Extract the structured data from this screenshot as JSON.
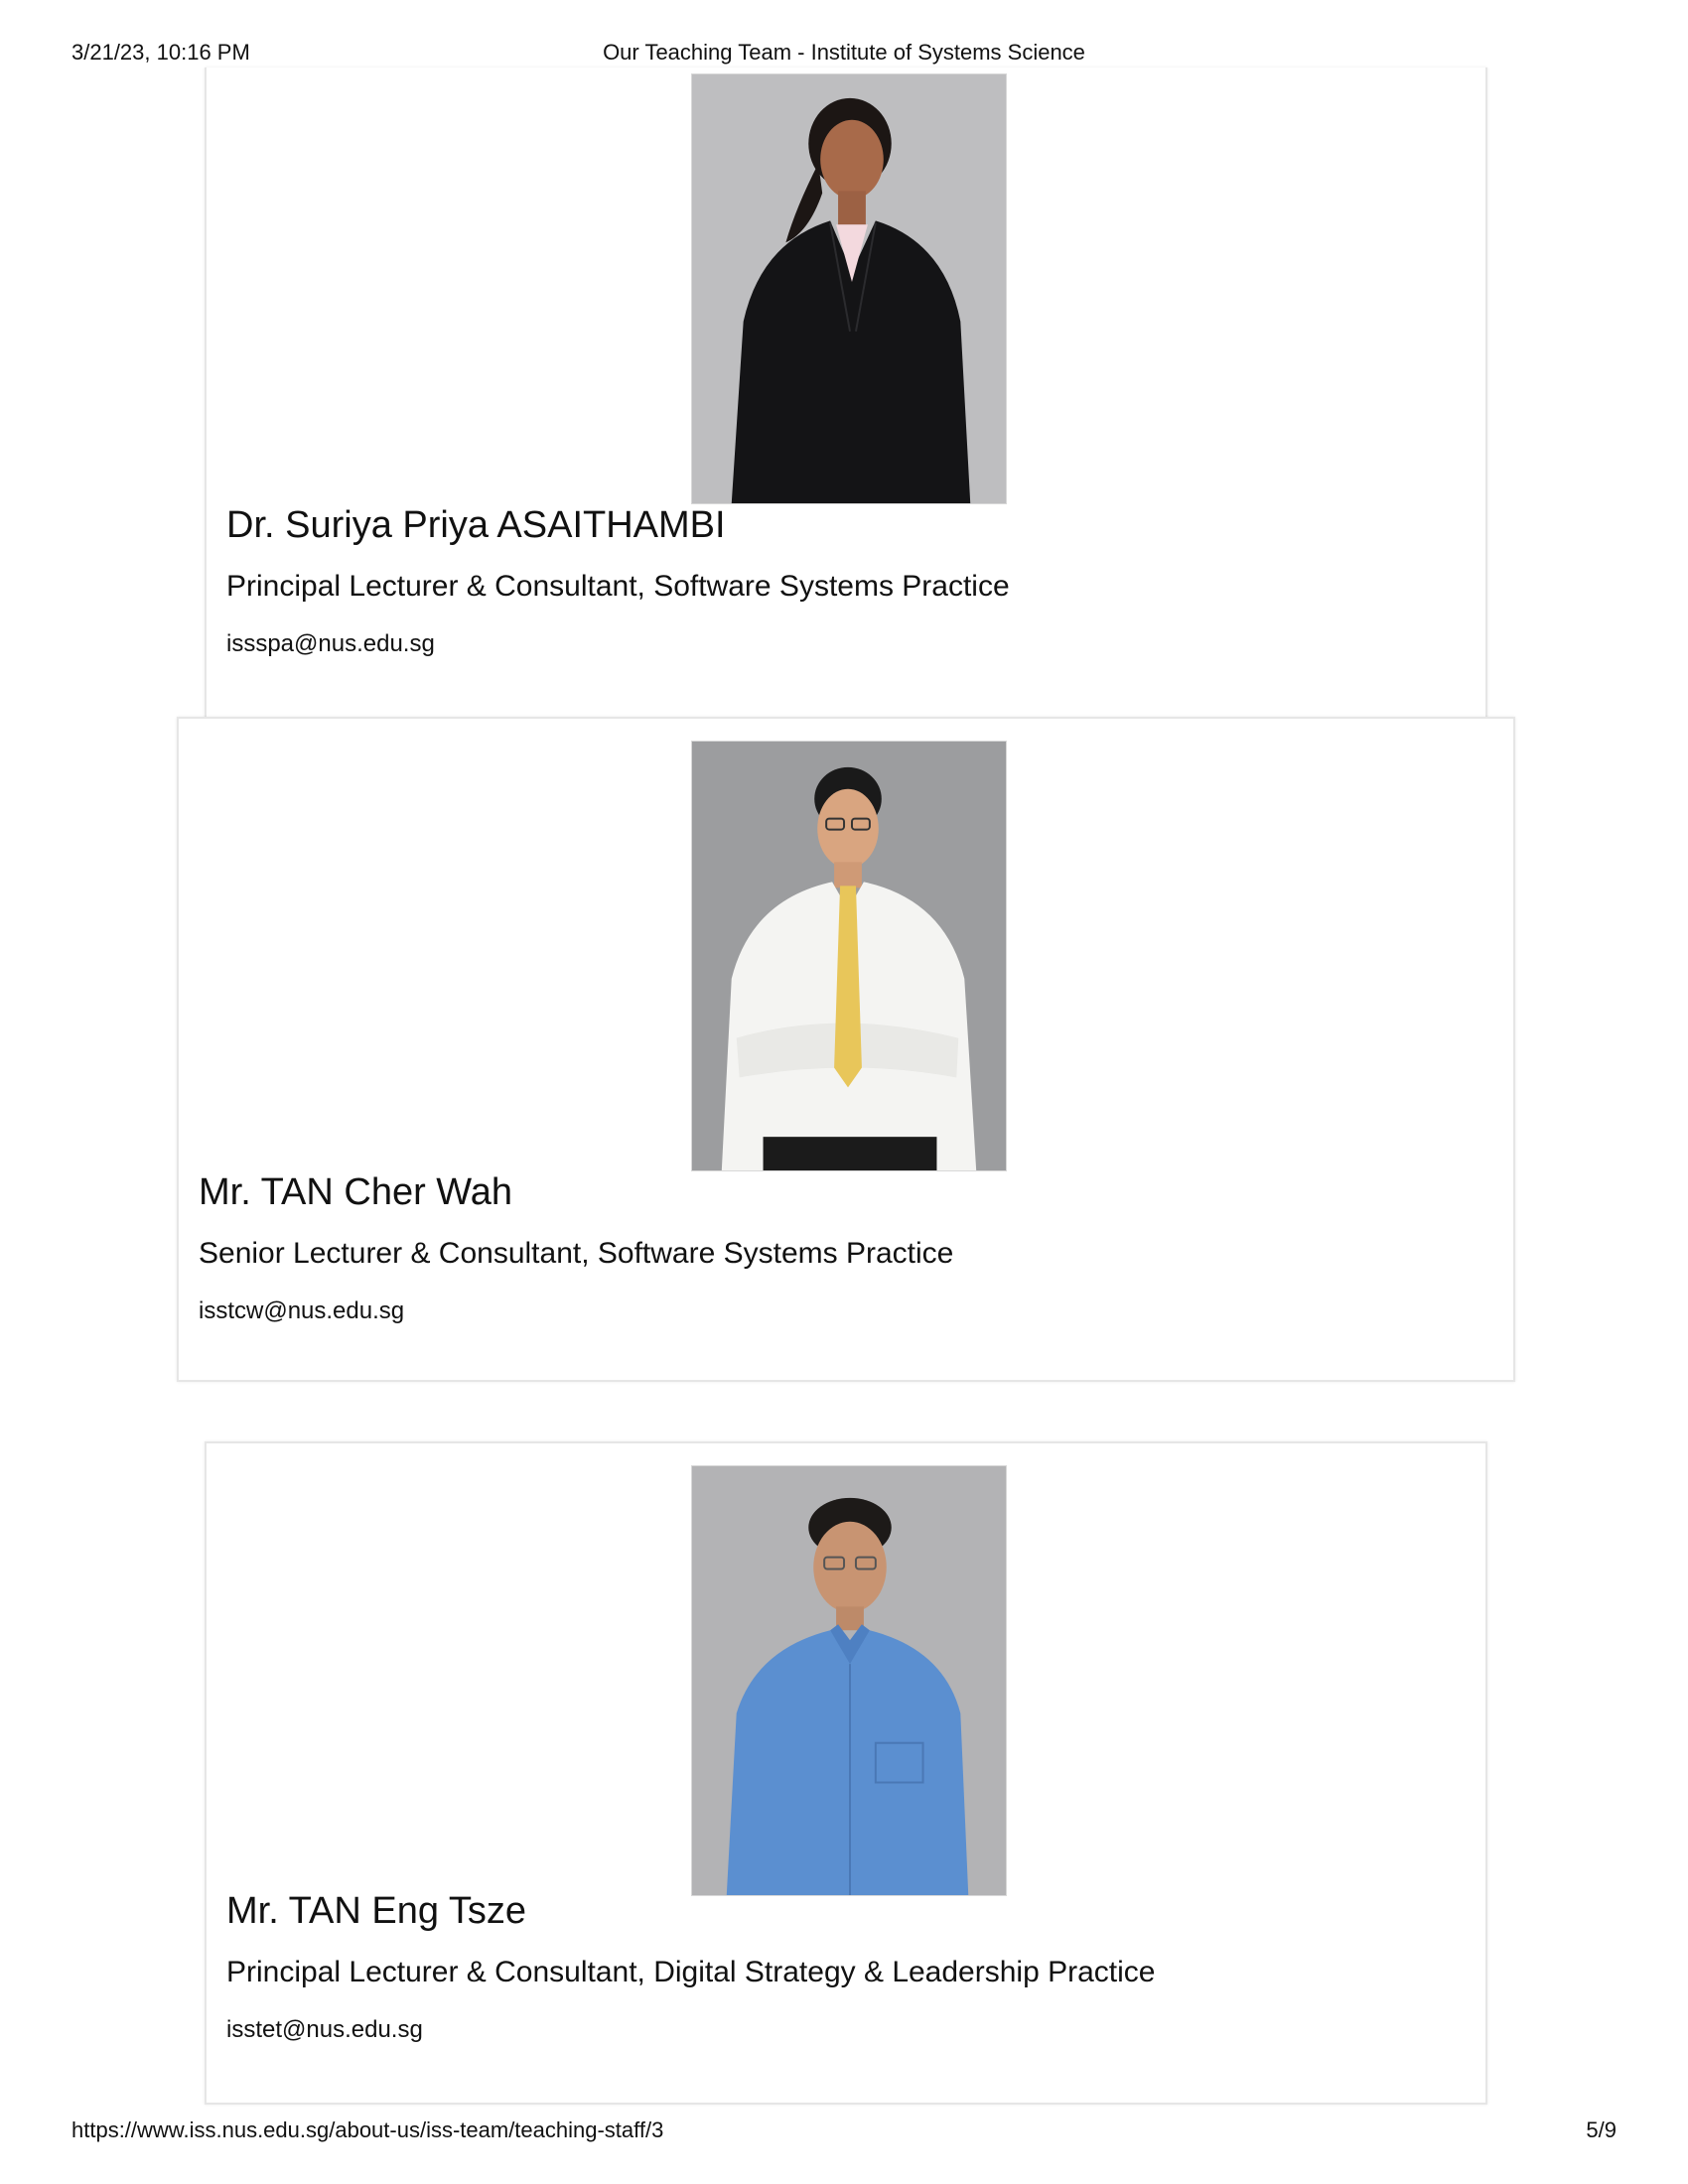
{
  "print_header": {
    "datetime": "3/21/23, 10:16 PM",
    "title": "Our Teaching Team - Institute of Systems Science"
  },
  "print_footer": {
    "url": "https://www.iss.nus.edu.sg/about-us/iss-team/teaching-staff/3",
    "page": "5/9"
  },
  "staff": [
    {
      "name": "Dr. Suriya Priya ASAITHAMBI",
      "role": "Principal Lecturer & Consultant, Software Systems Practice",
      "email": "issspa@nus.edu.sg"
    },
    {
      "name": "Mr. TAN Cher Wah",
      "role": "Senior Lecturer & Consultant, Software Systems Practice",
      "email": "isstcw@nus.edu.sg"
    },
    {
      "name": "Mr. TAN Eng Tsze",
      "role": "Principal Lecturer & Consultant, Digital Strategy & Leadership Practice",
      "email": "isstet@nus.edu.sg"
    }
  ]
}
